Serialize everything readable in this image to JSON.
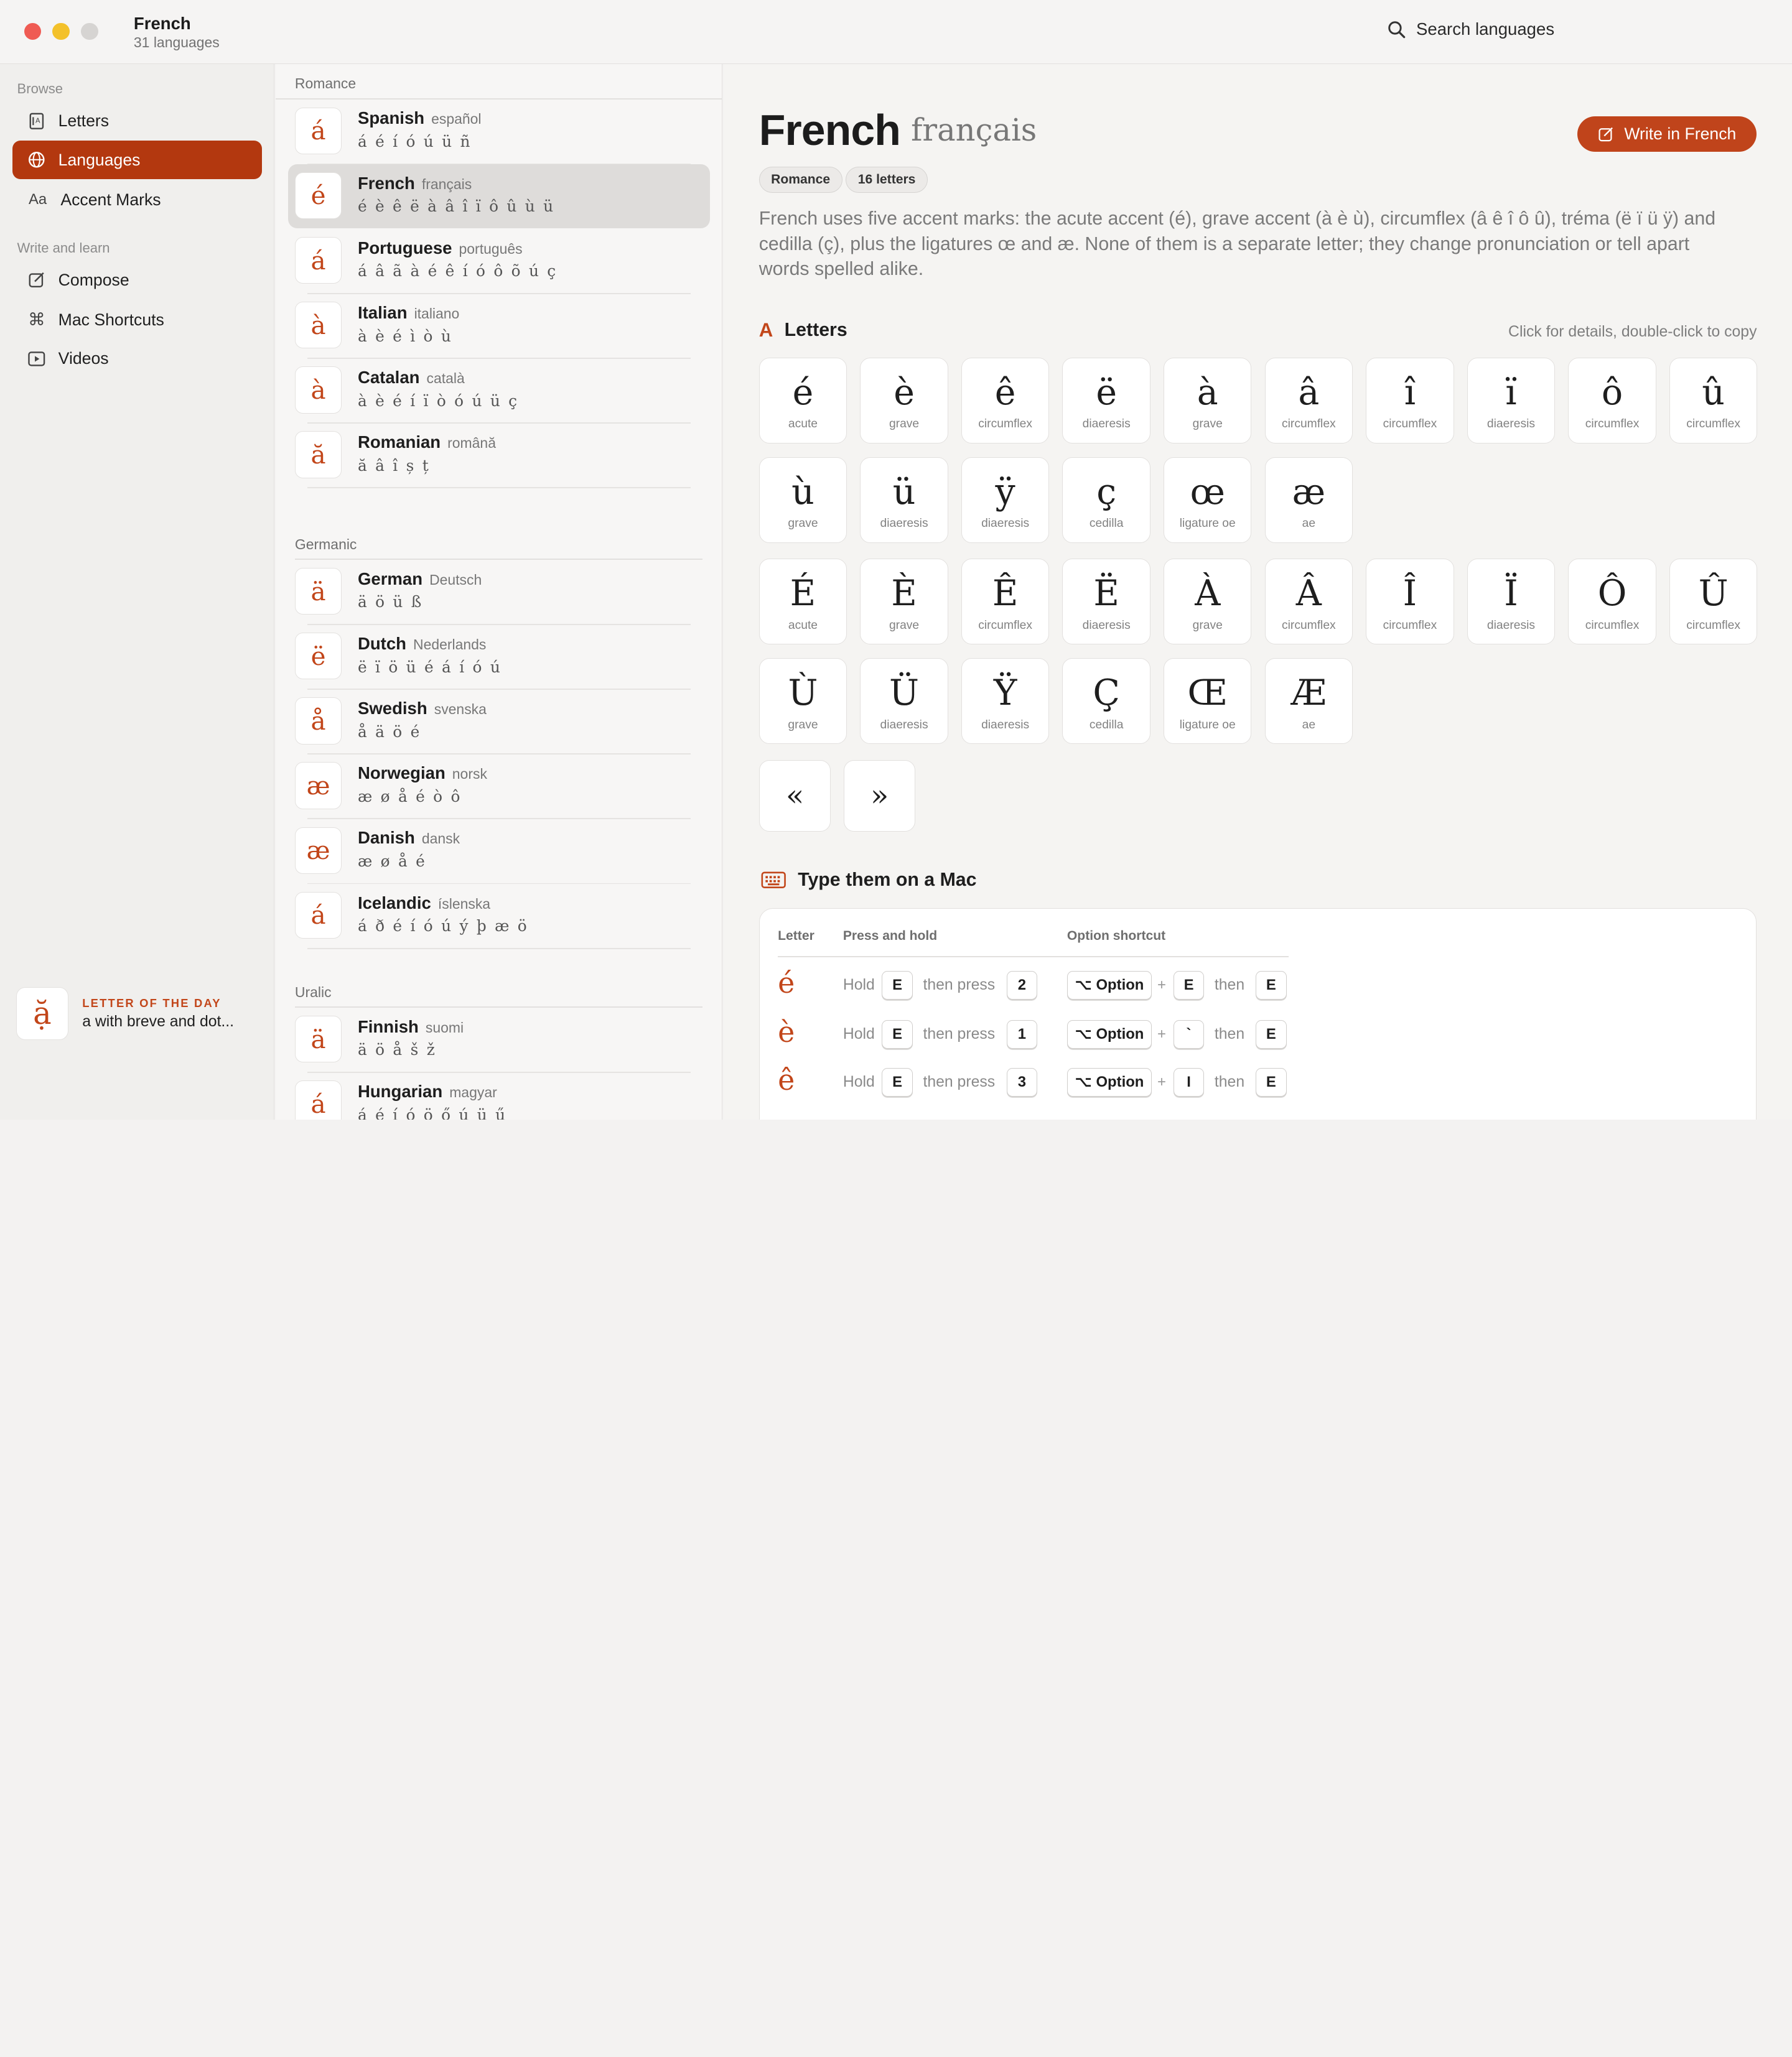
{
  "titlebar": {
    "title": "French",
    "subtitle": "31 languages",
    "search_placeholder": "Search languages"
  },
  "sidebar": {
    "browse_label": "Browse",
    "browse_items": [
      {
        "label": "Letters",
        "icon": "book-icon"
      },
      {
        "label": "Languages",
        "icon": "globe-icon",
        "active": true
      },
      {
        "label": "Accent Marks",
        "icon": "Aa"
      }
    ],
    "write_label": "Write and learn",
    "write_items": [
      {
        "label": "Compose",
        "icon": "edit-icon"
      },
      {
        "label": "Mac Shortcuts",
        "icon": "command-icon"
      },
      {
        "label": "Videos",
        "icon": "play-icon"
      }
    ],
    "letter_of_day": {
      "caption": "LETTER OF THE DAY",
      "letter": "ặ",
      "text": "a with breve and dot..."
    }
  },
  "list": {
    "groups": [
      {
        "name": "Romance",
        "items": [
          {
            "tile": "á",
            "name": "Spanish",
            "native": "español",
            "chars": "á é í ó ú ü ñ"
          },
          {
            "tile": "é",
            "name": "French",
            "native": "français",
            "chars": "é è ê ë à â î ï ô û ù ü",
            "selected": true
          },
          {
            "tile": "á",
            "name": "Portuguese",
            "native": "português",
            "chars": "á â ã à é ê í ó ô õ ú ç"
          },
          {
            "tile": "à",
            "name": "Italian",
            "native": "italiano",
            "chars": "à è é ì ò ù"
          },
          {
            "tile": "à",
            "name": "Catalan",
            "native": "català",
            "chars": "à è é í ï ò ó ú ü ç"
          },
          {
            "tile": "ă",
            "name": "Romanian",
            "native": "română",
            "chars": "ă â î ș ț"
          }
        ]
      },
      {
        "name": "Germanic",
        "items": [
          {
            "tile": "ä",
            "name": "German",
            "native": "Deutsch",
            "chars": "ä ö ü ß"
          },
          {
            "tile": "ë",
            "name": "Dutch",
            "native": "Nederlands",
            "chars": "ë ï ö ü é á í ó ú"
          },
          {
            "tile": "å",
            "name": "Swedish",
            "native": "svenska",
            "chars": "å ä ö é"
          },
          {
            "tile": "æ",
            "name": "Norwegian",
            "native": "norsk",
            "chars": "æ ø å é ò ô"
          },
          {
            "tile": "æ",
            "name": "Danish",
            "native": "dansk",
            "chars": "æ ø å é"
          },
          {
            "tile": "á",
            "name": "Icelandic",
            "native": "íslenska",
            "chars": "á ð é í ó ú ý þ æ ö"
          }
        ]
      },
      {
        "name": "Uralic",
        "items": [
          {
            "tile": "ä",
            "name": "Finnish",
            "native": "suomi",
            "chars": "ä ö å š ž"
          },
          {
            "tile": "á",
            "name": "Hungarian",
            "native": "magyar",
            "chars": "á é í ó ö ő ú ü ű"
          }
        ]
      }
    ]
  },
  "detail": {
    "title": "French",
    "native": "français",
    "write_button": "Write in French",
    "chips": [
      "Romance",
      "16 letters"
    ],
    "description": "French uses five accent marks: the acute accent (é), grave accent (à è ù), circumflex (â ê î ô û), tréma (ë ï ü ÿ) and cedilla (ç), plus the ligatures œ and æ. None of them is a separate letter; they change pronunciation or tell apart words spelled alike.",
    "letters_title": "Letters",
    "letters_hint": "Click for details, double-click to copy",
    "lowercase": [
      {
        "ch": "é",
        "mark": "acute"
      },
      {
        "ch": "è",
        "mark": "grave"
      },
      {
        "ch": "ê",
        "mark": "circumflex"
      },
      {
        "ch": "ë",
        "mark": "diaeresis"
      },
      {
        "ch": "à",
        "mark": "grave"
      },
      {
        "ch": "â",
        "mark": "circumflex"
      },
      {
        "ch": "î",
        "mark": "circumflex"
      },
      {
        "ch": "ï",
        "mark": "diaeresis"
      },
      {
        "ch": "ô",
        "mark": "circumflex"
      },
      {
        "ch": "û",
        "mark": "circumflex"
      },
      {
        "ch": "ù",
        "mark": "grave"
      },
      {
        "ch": "ü",
        "mark": "diaeresis"
      },
      {
        "ch": "ÿ",
        "mark": "diaeresis"
      },
      {
        "ch": "ç",
        "mark": "cedilla"
      },
      {
        "ch": "œ",
        "mark": "ligature oe"
      },
      {
        "ch": "æ",
        "mark": "ae"
      }
    ],
    "uppercase": [
      {
        "ch": "É",
        "mark": "acute"
      },
      {
        "ch": "È",
        "mark": "grave"
      },
      {
        "ch": "Ê",
        "mark": "circumflex"
      },
      {
        "ch": "Ë",
        "mark": "diaeresis"
      },
      {
        "ch": "À",
        "mark": "grave"
      },
      {
        "ch": "Â",
        "mark": "circumflex"
      },
      {
        "ch": "Î",
        "mark": "circumflex"
      },
      {
        "ch": "Ï",
        "mark": "diaeresis"
      },
      {
        "ch": "Ô",
        "mark": "circumflex"
      },
      {
        "ch": "Û",
        "mark": "circumflex"
      },
      {
        "ch": "Ù",
        "mark": "grave"
      },
      {
        "ch": "Ü",
        "mark": "diaeresis"
      },
      {
        "ch": "Ÿ",
        "mark": "diaeresis"
      },
      {
        "ch": "Ç",
        "mark": "cedilla"
      },
      {
        "ch": "Œ",
        "mark": "ligature oe"
      },
      {
        "ch": "Æ",
        "mark": "ae"
      }
    ],
    "quotes": [
      "«",
      "»"
    ],
    "mac_title": "Type them on a Mac",
    "table_headers": {
      "letter": "Letter",
      "press_hold": "Press and hold",
      "option": "Option shortcut"
    },
    "table_words": {
      "hold": "Hold",
      "then_press": "then press",
      "then": "then",
      "plus": "+"
    },
    "rows": [
      {
        "letter": "é",
        "hold_key": "E",
        "number": "2",
        "option_key": "⌥ Option",
        "accent_key": "E",
        "final_key": "E"
      },
      {
        "letter": "è",
        "hold_key": "E",
        "number": "1",
        "option_key": "⌥ Option",
        "accent_key": "`",
        "final_key": "E"
      },
      {
        "letter": "ê",
        "hold_key": "E",
        "number": "3",
        "option_key": "⌥ Option",
        "accent_key": "I",
        "final_key": "E"
      }
    ]
  }
}
